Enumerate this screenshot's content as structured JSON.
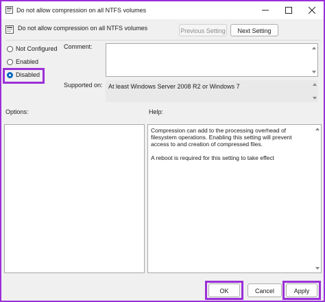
{
  "window": {
    "title": "Do not allow compression on all NTFS volumes"
  },
  "header": {
    "policy_name": "Do not allow compression on all NTFS volumes",
    "previous_label": "Previous Setting",
    "next_label": "Next Setting"
  },
  "state": {
    "options": [
      {
        "label": "Not Configured",
        "checked": false
      },
      {
        "label": "Enabled",
        "checked": false
      },
      {
        "label": "Disabled",
        "checked": true
      }
    ]
  },
  "comment": {
    "label": "Comment:",
    "value": ""
  },
  "supported": {
    "label": "Supported on:",
    "value": "At least Windows Server 2008 R2 or Windows 7"
  },
  "options_panel": {
    "label": "Options:"
  },
  "help_panel": {
    "label": "Help:",
    "text": "Compression can add to the processing overhead of filesystem operations.  Enabling this setting will prevent access to and creation of compressed files.\n\nA reboot is required for this setting to take effect"
  },
  "footer": {
    "ok_label": "OK",
    "cancel_label": "Cancel",
    "apply_label": "Apply"
  },
  "colors": {
    "highlight": "#9b2fd8",
    "radio_accent": "#0067c0"
  },
  "icons": [
    "policy-icon",
    "minimize-icon",
    "maximize-icon",
    "close-icon",
    "scroll-up-arrow-icon",
    "scroll-down-arrow-icon"
  ]
}
